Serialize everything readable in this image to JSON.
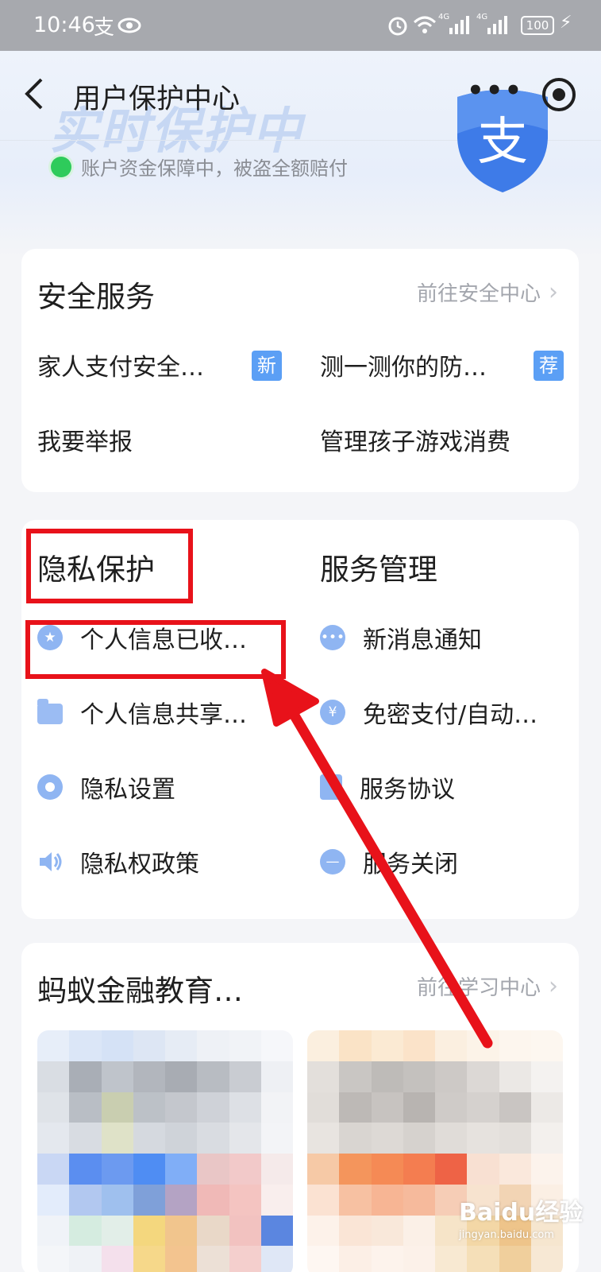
{
  "status_bar": {
    "time": "10:46",
    "alipay_glyph": "支",
    "eye_icon": "eye-icon",
    "alarm_icon": "alarm-icon",
    "wifi_icon": "wifi-icon",
    "net_label_1": "4G",
    "net_label_2": "4G",
    "battery": "100",
    "charging_icon": "bolt-icon"
  },
  "header": {
    "title": "用户保护中心",
    "hero_text": "实时保护中",
    "shield_glyph": "支",
    "notice": "账户资金保障中，被盗全额赔付"
  },
  "security_service": {
    "title": "安全服务",
    "link": "前往安全中心",
    "items": [
      {
        "label": "家人支付安全…",
        "tag": "新"
      },
      {
        "label": "测一测你的防…",
        "tag": "荐"
      },
      {
        "label": "我要举报"
      },
      {
        "label": "管理孩子游戏消费"
      }
    ]
  },
  "privacy": {
    "title": "隐私保护",
    "items": [
      {
        "label": "个人信息已收…",
        "icon": "star-circle-icon"
      },
      {
        "label": "个人信息共享…",
        "icon": "folder-icon"
      },
      {
        "label": "隐私设置",
        "icon": "gear-icon"
      },
      {
        "label": "隐私权政策",
        "icon": "speaker-icon"
      }
    ]
  },
  "service_mgmt": {
    "title": "服务管理",
    "items": [
      {
        "label": "新消息通知",
        "icon": "chat-bubble-icon"
      },
      {
        "label": "免密支付/自动…",
        "icon": "yen-circle-icon"
      },
      {
        "label": "服务协议",
        "icon": "document-icon"
      },
      {
        "label": "服务关闭",
        "icon": "minus-circle-icon"
      }
    ]
  },
  "education": {
    "title": "蚂蚁金融教育…",
    "link": "前往学习中心"
  },
  "watermark": {
    "text": "Baidu经验",
    "sub": "jingyan.baidu.com"
  },
  "colors": {
    "accent_blue": "#5b9ff5",
    "highlight_red": "#e8121a",
    "status_green": "#2ecb5b"
  }
}
